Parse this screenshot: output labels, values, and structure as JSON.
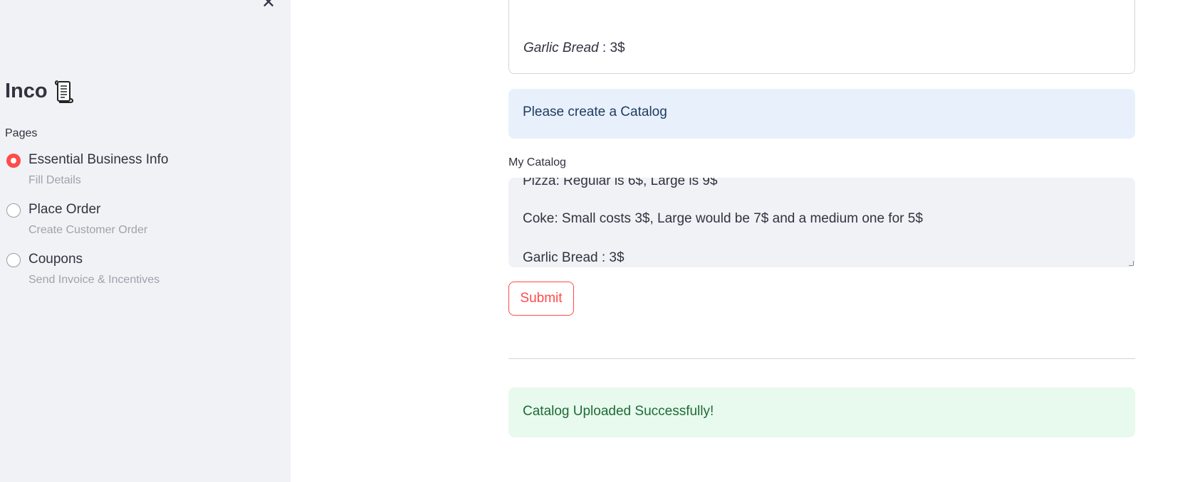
{
  "sidebar": {
    "close_icon": "✕",
    "app_title": "Inco",
    "app_icon": "scroll-icon",
    "pages_label": "Pages",
    "items": [
      {
        "label": "Essential Business Info",
        "caption": "Fill Details",
        "selected": true
      },
      {
        "label": "Place Order",
        "caption": "Create Customer Order",
        "selected": false
      },
      {
        "label": "Coupons",
        "caption": "Send Invoice & Incentives",
        "selected": false
      }
    ]
  },
  "main": {
    "previous_output": {
      "item_name": "Garlic Bread",
      "item_price": " : 3$"
    },
    "info_message": "Please create a Catalog",
    "catalog_label": "My Catalog",
    "catalog_lines": [
      "Pizza: Regular is 6$, Large is 9$",
      "Coke: Small costs 3$, Large would be 7$ and a medium one for 5$",
      "Garlic Bread : 3$"
    ],
    "submit_label": "Submit",
    "success_message": "Catalog Uploaded Successfully!"
  },
  "colors": {
    "accent": "#ff4b4b",
    "sidebar_bg": "#f0f2f6",
    "info_bg": "#e8f1fb",
    "success_bg": "#e8f9ee"
  }
}
